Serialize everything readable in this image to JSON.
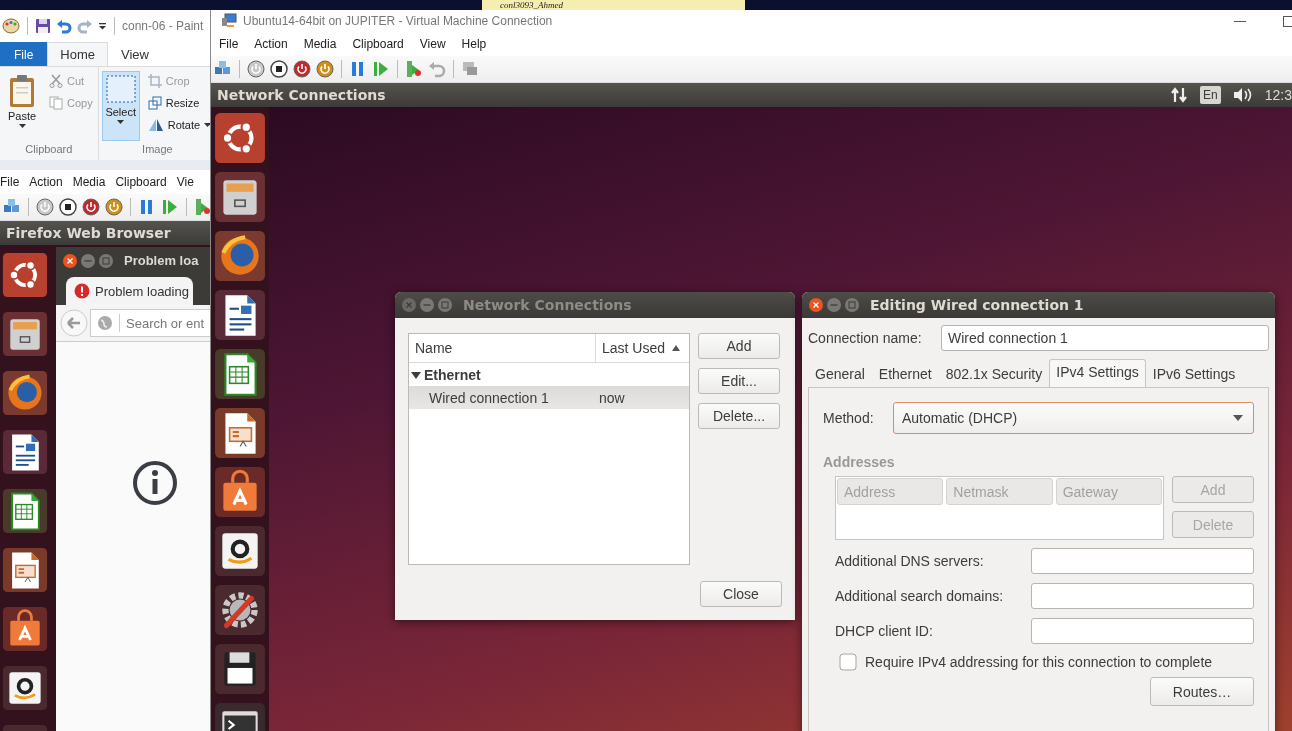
{
  "sticky_note": {
    "text": "conl3093_Ahmed"
  },
  "paint_window": {
    "title": "conn-06 - Paint",
    "tabs": [
      {
        "label": "File",
        "kind": "menu",
        "selected": false
      },
      {
        "label": "Home",
        "kind": "tab",
        "selected": true
      },
      {
        "label": "View",
        "kind": "tab",
        "selected": false
      }
    ],
    "groups": [
      {
        "label": "Clipboard",
        "items": [
          {
            "label": "Paste",
            "kind": "large",
            "selected": false,
            "disabled": false
          },
          {
            "label": "Cut",
            "kind": "small",
            "selected": false,
            "disabled": true
          },
          {
            "label": "Copy",
            "kind": "small",
            "selected": false,
            "disabled": true
          }
        ]
      },
      {
        "label": "Image",
        "items": [
          {
            "label": "Select",
            "kind": "large",
            "selected": true,
            "disabled": false
          },
          {
            "label": "Crop",
            "kind": "small",
            "selected": false,
            "disabled": true
          },
          {
            "label": "Resize",
            "kind": "small",
            "selected": false,
            "disabled": false
          },
          {
            "label": "Rotate",
            "kind": "small-dropdown",
            "selected": false,
            "disabled": false
          }
        ]
      }
    ]
  },
  "back_vm_window": {
    "menu": [
      "File",
      "Action",
      "Media",
      "Clipboard",
      "Vie"
    ],
    "panel_title": "Firefox Web Browser",
    "browser": {
      "title": "Problem loa",
      "tab": "Problem loading",
      "address_placeholder": "Search or ent"
    }
  },
  "vm_window": {
    "title": "Ubuntu14-64bit on JUPITER - Virtual Machine Connection",
    "menu": [
      "File",
      "Action",
      "Media",
      "Clipboard",
      "View",
      "Help"
    ],
    "panel_title": "Network Connections",
    "keyboard_layout": "En",
    "clock": "12:3"
  },
  "network_connections": {
    "title": "Network Connections",
    "focused": false,
    "columns": [
      {
        "label": "Name",
        "sorted": false
      },
      {
        "label": "Last Used",
        "sorted": true
      }
    ],
    "groups": [
      {
        "name": "Ethernet",
        "expanded": true,
        "children": [
          {
            "name": "Wired connection 1",
            "last_used": "now",
            "selected": true
          }
        ]
      }
    ],
    "buttons": [
      "Add",
      "Edit...",
      "Delete..."
    ],
    "close_button": "Close"
  },
  "editor": {
    "title": "Editing Wired connection 1",
    "focused": true,
    "connection_name_label": "Connection name:",
    "connection_name": "Wired connection 1",
    "tabs": [
      {
        "label": "General",
        "selected": false
      },
      {
        "label": "Ethernet",
        "selected": false
      },
      {
        "label": "802.1x Security",
        "selected": false
      },
      {
        "label": "IPv4 Settings",
        "selected": true
      },
      {
        "label": "IPv6 Settings",
        "selected": false
      }
    ],
    "method_label": "Method:",
    "method": "Automatic (DHCP)",
    "addresses_heading": "Addresses",
    "addresses_disabled": true,
    "address_columns": [
      "Address",
      "Netmask",
      "Gateway"
    ],
    "address_buttons": [
      {
        "label": "Add",
        "disabled": true
      },
      {
        "label": "Delete",
        "disabled": true
      }
    ],
    "fields": [
      {
        "label": "Additional DNS servers:"
      },
      {
        "label": "Additional search domains:"
      },
      {
        "label": "DHCP client ID:"
      }
    ],
    "require_ipv4": {
      "label": "Require IPv4 addressing for this connection to complete",
      "checked": false
    },
    "routes_button": "Routes…"
  }
}
